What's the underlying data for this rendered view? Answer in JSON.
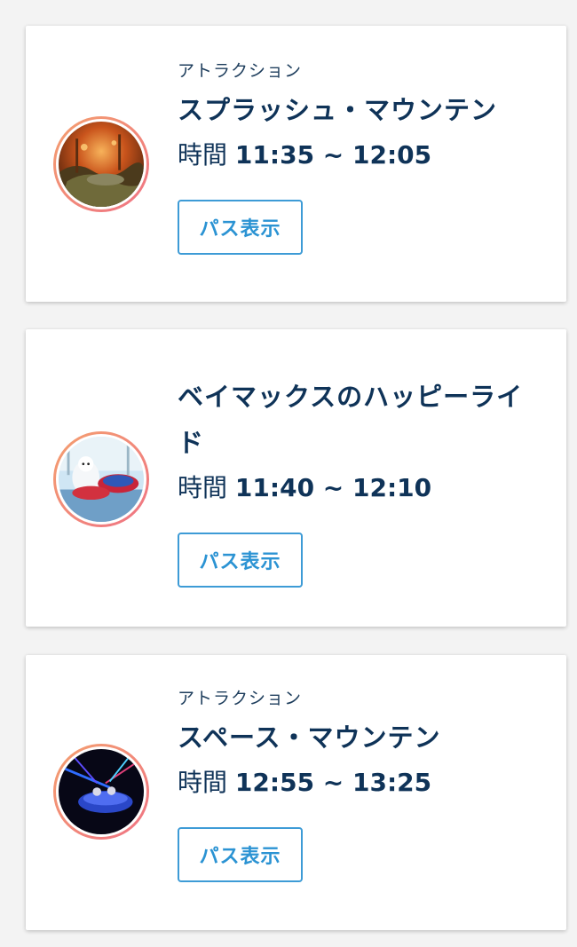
{
  "reservations": [
    {
      "category": "アトラクション",
      "name": "スプラッシュ・マウンテン",
      "time_label": "時間",
      "time_range": "11:35 ~ 12:05",
      "button_label": "パス表示",
      "image_icon": "splash-mountain-photo"
    },
    {
      "category": "",
      "name": "ベイマックスのハッピーライド",
      "time_label": "時間",
      "time_range": "11:40 ~ 12:10",
      "button_label": "パス表示",
      "image_icon": "baymax-happy-ride-photo"
    },
    {
      "category": "アトラクション",
      "name": "スペース・マウンテン",
      "time_label": "時間",
      "time_range": "12:55 ~ 13:25",
      "button_label": "パス表示",
      "image_icon": "space-mountain-photo"
    }
  ],
  "colors": {
    "text_primary": "#0f3358",
    "button_border": "#3d9bd6",
    "button_text": "#2b93d3",
    "thumb_ring_start": "#f4a06f",
    "thumb_ring_end": "#ef7384"
  }
}
